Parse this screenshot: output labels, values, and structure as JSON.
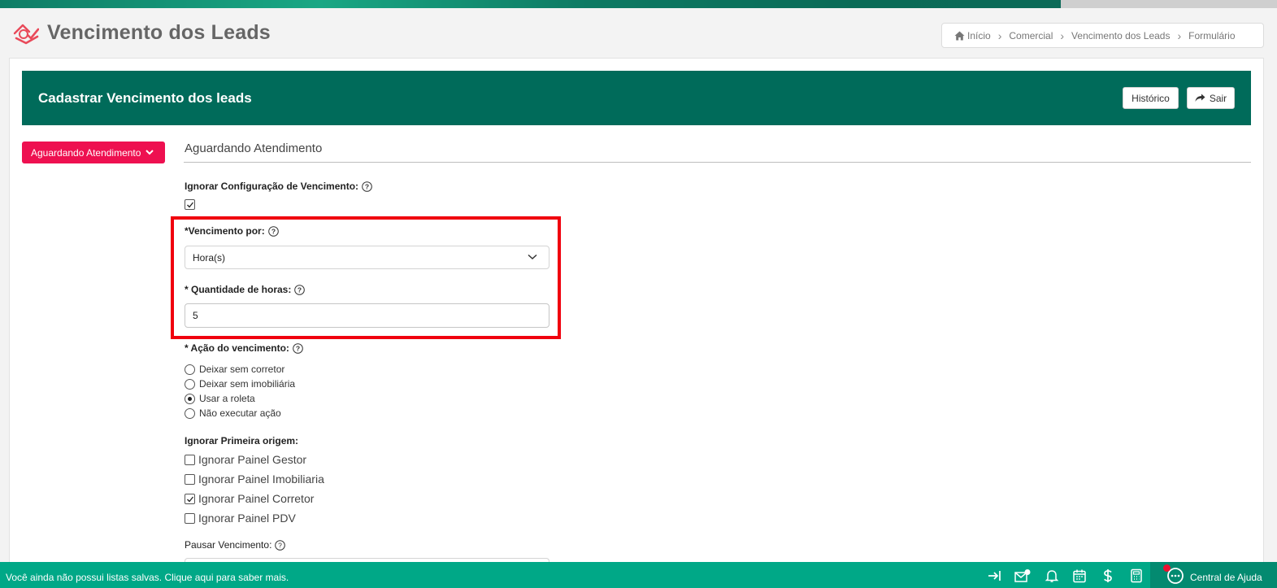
{
  "page": {
    "title": "Vencimento dos Leads",
    "logo_icon": "house-check-logo-icon"
  },
  "breadcrumb": {
    "items": [
      "Início",
      "Comercial",
      "Vencimento dos Leads",
      "Formulário"
    ]
  },
  "form_header": {
    "title": "Cadastrar Vencimento dos leads",
    "historico_label": "Histórico",
    "sair_label": "Sair"
  },
  "status_dropdown": {
    "label": "Aguardando Atendimento"
  },
  "section": {
    "title": "Aguardando Atendimento"
  },
  "fields": {
    "ignorar_config_label": "Ignorar Configuração de Vencimento:",
    "ignorar_config_checked": true,
    "vencimento_por_label": "*Vencimento por:",
    "vencimento_por_value": "Hora(s)",
    "quantidade_label": "* Quantidade de horas:",
    "quantidade_value": "5",
    "acao_label": "* Ação do vencimento:",
    "acao_options": [
      {
        "label": "Deixar sem corretor",
        "checked": false
      },
      {
        "label": "Deixar sem imobiliária",
        "checked": false
      },
      {
        "label": "Usar a roleta",
        "checked": true
      },
      {
        "label": "Não executar ação",
        "checked": false
      }
    ],
    "ignorar_origem_label": "Ignorar Primeira origem:",
    "origem_options": [
      {
        "label": "Ignorar Painel Gestor",
        "checked": false
      },
      {
        "label": "Ignorar Painel Imobiliaria",
        "checked": false
      },
      {
        "label": "Ignorar Painel Corretor",
        "checked": true
      },
      {
        "label": "Ignorar Painel PDV",
        "checked": false
      }
    ],
    "pausar_label": "Pausar Vencimento:"
  },
  "bottom_bar": {
    "message": "Você ainda não possui listas salvas. Clique aqui para saber mais.",
    "help_center_label": "Central de Ajuda",
    "icons": [
      "collapse-right-icon",
      "mail-settings-icon",
      "bell-icon",
      "calendar-icon",
      "dollar-icon",
      "calculator-icon",
      "chat-icon"
    ]
  },
  "colors": {
    "header_green": "#006b5a",
    "bottom_bar_green": "#00a887",
    "status_pink": "#ee1050",
    "highlight_red": "#f0000e"
  }
}
